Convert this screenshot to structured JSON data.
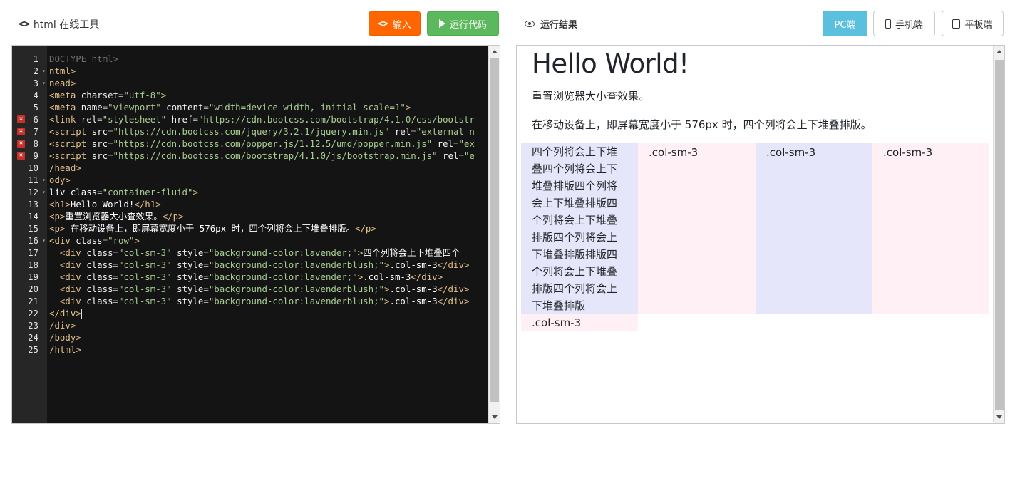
{
  "header": {
    "tool_title": "html 在线工具",
    "input_button": "输入",
    "run_button": "运行代码",
    "result_title": "运行结果",
    "device_pc": "PC端",
    "device_phone": "手机端",
    "device_tablet": "平板端"
  },
  "colors": {
    "input_button": "#ff6600",
    "run_button": "#5cb85c",
    "device_pc": "#5bc0de",
    "editor_bg": "#141414",
    "gutter_bg": "#262626"
  },
  "editor": {
    "line_numbers": [
      "1",
      "2",
      "3",
      "4",
      "5",
      "6",
      "7",
      "8",
      "9",
      "10",
      "11",
      "12",
      "13",
      "14",
      "15",
      "16",
      "17",
      "18",
      "19",
      "20",
      "21",
      "22",
      "23",
      "24",
      "25"
    ],
    "error_lines": [
      6,
      7,
      8,
      9
    ],
    "folded_lines": [
      2,
      3,
      11,
      12,
      16
    ],
    "lines": [
      "DOCTYPE html>",
      "ntml>",
      "nead>",
      "<meta charset=\"utf-8\">",
      "<meta name=\"viewport\" content=\"width=device-width, initial-scale=1\">",
      "<link rel=\"stylesheet\" href=\"https://cdn.bootcss.com/bootstrap/4.1.0/css/bootstr",
      "<script src=\"https://cdn.bootcss.com/jquery/3.2.1/jquery.min.js\" rel=\"external n",
      "<script src=\"https://cdn.bootcss.com/popper.js/1.12.5/umd/popper.min.js\" rel=\"ex",
      "<script src=\"https://cdn.bootcss.com/bootstrap/4.1.0/js/bootstrap.min.js\" rel=\"e",
      "/head>",
      "ody>",
      "liv class=\"container-fluid\">",
      "<h1>Hello World!</h1>",
      "<p>重置浏览器大小查效果。</p>",
      "<p> 在移动设备上，即屏幕宽度小于 576px 时，四个列将会上下堆叠排版。</p>",
      "<div class=\"row\">",
      "  <div class=\"col-sm-3\" style=\"background-color:lavender;\">四个列将会上下堆叠四个",
      "  <div class=\"col-sm-3\" style=\"background-color:lavenderblush;\">.col-sm-3</div>",
      "  <div class=\"col-sm-3\" style=\"background-color:lavender;\">.col-sm-3</div>",
      "  <div class=\"col-sm-3\" style=\"background-color:lavenderblush;\">.col-sm-3</div>",
      "  <div class=\"col-sm-3\" style=\"background-color:lavenderblush;\">.col-sm-3</div>",
      "</div>",
      "/div>",
      "/body>",
      "/html>"
    ]
  },
  "preview": {
    "heading": "Hello World!",
    "para1": "重置浏览器大小查效果。",
    "para2": "在移动设备上，即屏幕宽度小于 576px 时，四个列将会上下堆叠排版。",
    "col1_lines": [
      "四个列将会上下堆",
      "叠四个列将会上下",
      "堆叠排版四个列将",
      "会上下堆叠排版四",
      "个列将会上下堆叠",
      "排版四个列将会上",
      "下堆叠排版排版四",
      "个列将会上下堆叠",
      "排版四个列将会上",
      "下堆叠排版"
    ],
    "col2": ".col-sm-3",
    "col3": ".col-sm-3",
    "col4": ".col-sm-3",
    "col5": ".col-sm-3"
  }
}
